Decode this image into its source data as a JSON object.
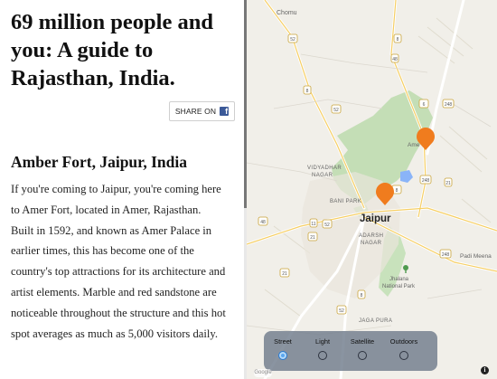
{
  "story": {
    "headline_lines": [
      "69 million people and",
      "you: A guide to",
      "Rajasthan, India."
    ],
    "share": {
      "label": "SHARE ON",
      "icon": "facebook-icon",
      "icon_glyph": "f"
    },
    "section_title": "Amber Fort, Jaipur, India",
    "body_lines": [
      "If you're coming to Jaipur, you're coming here",
      "to Amer Fort, located in Amer, Rajasthan.",
      "Built in 1592, and known as Amer Palace in",
      "earlier times, this has become one of the",
      "country's top attractions for its architecture and",
      "artist elements. Marble and red sandstone are",
      "noticeable throughout the structure and this hot",
      "spot averages as much as 5,000 visitors daily."
    ]
  },
  "map": {
    "city_label": "Jaipur",
    "place_labels": {
      "chomu": "Chomu",
      "vidyadhar": [
        "VIDYADHAR",
        "NAGAR"
      ],
      "bani_park": "BANI PARK",
      "adarsh": [
        "ADARSH",
        "NAGAR"
      ],
      "jhalana": [
        "Jhalana",
        "National Park"
      ],
      "jaga_pura": "JAGA PURA",
      "padi_meena": "Padi Meena",
      "amer": "Ame"
    },
    "highway_shields": [
      "52",
      "8",
      "48",
      "8",
      "6",
      "52",
      "248",
      "248",
      "21",
      "8",
      "11",
      "48",
      "52",
      "21",
      "248",
      "21",
      "8",
      "52"
    ],
    "marker_color": "#f07c1e",
    "park_color": "#bfdcb0",
    "water_color": "#8ab4f8",
    "basemap_options": [
      {
        "label": "Street",
        "selected": true
      },
      {
        "label": "Light",
        "selected": false
      },
      {
        "label": "Satellite",
        "selected": false
      },
      {
        "label": "Outdoors",
        "selected": false
      }
    ],
    "attribution_logo": "Google",
    "info_glyph": "i"
  }
}
